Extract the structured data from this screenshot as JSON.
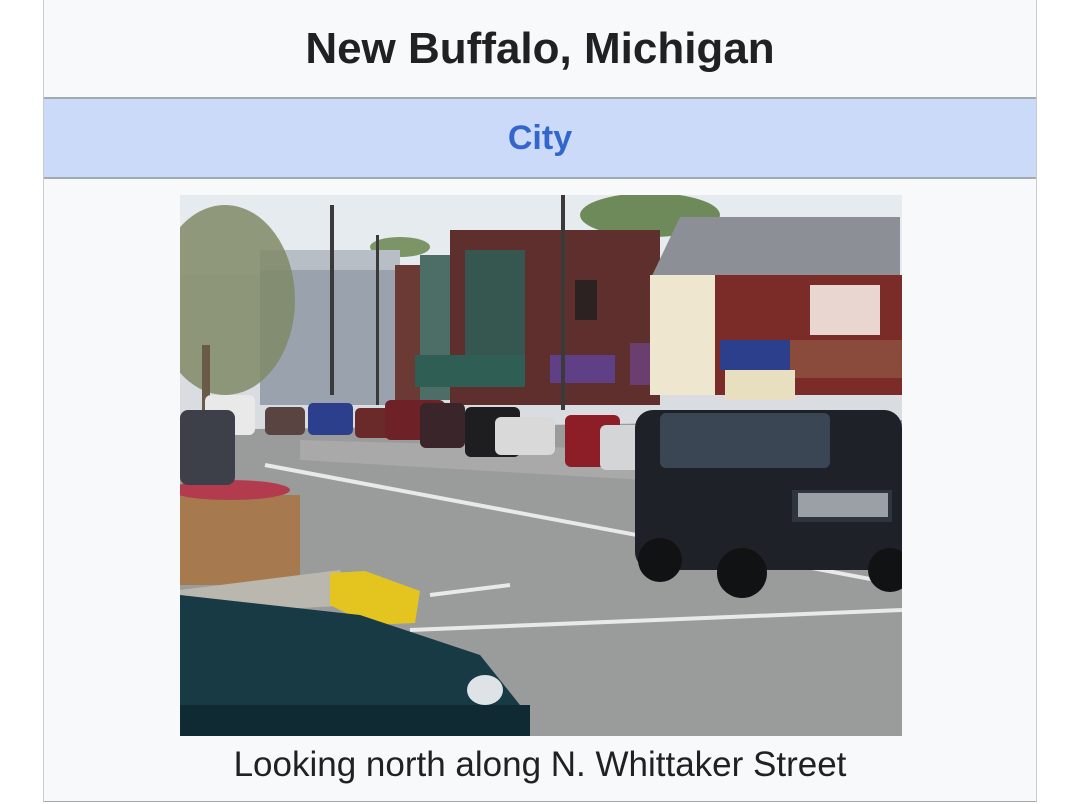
{
  "infobox": {
    "title": "New Buffalo, Michigan",
    "settlement_type": "City",
    "image": {
      "caption": "Looking north along N. Whittaker Street"
    }
  },
  "colors": {
    "title_text": "#202122",
    "type_band": "#ccdaf9",
    "type_link": "#3366cc",
    "infobox_bg": "#f8f9fa"
  }
}
